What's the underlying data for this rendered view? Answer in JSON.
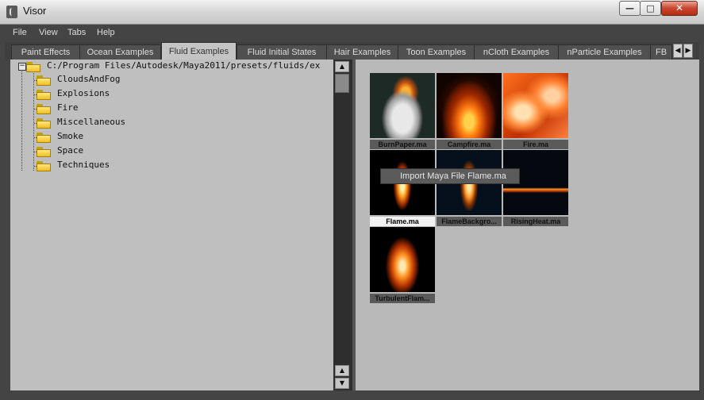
{
  "window": {
    "title": "Visor"
  },
  "menu": [
    "File",
    "View",
    "Tabs",
    "Help"
  ],
  "tabs": [
    {
      "label": "Paint Effects",
      "active": false
    },
    {
      "label": "Ocean Examples",
      "active": false
    },
    {
      "label": "Fluid Examples",
      "active": true
    },
    {
      "label": "Fluid Initial States",
      "active": false
    },
    {
      "label": "Hair Examples",
      "active": false
    },
    {
      "label": "Toon Examples",
      "active": false
    },
    {
      "label": "nCloth Examples",
      "active": false
    },
    {
      "label": "nParticle Examples",
      "active": false
    },
    {
      "label": "FB",
      "active": false
    }
  ],
  "tree": {
    "root": "C:/Program Files/Autodesk/Maya2011/presets/fluids/ex",
    "folders": [
      "CloudsAndFog",
      "Explosions",
      "Fire",
      "Miscellaneous",
      "Smoke",
      "Space",
      "Techniques"
    ]
  },
  "thumbnails": [
    {
      "label": "BurnPaper.ma",
      "selected": false
    },
    {
      "label": "Campfire.ma",
      "selected": false
    },
    {
      "label": "Fire.ma",
      "selected": false
    },
    {
      "label": "Flame.ma",
      "selected": true
    },
    {
      "label": "FlameBackgro...",
      "selected": false
    },
    {
      "label": "RisingHeat.ma",
      "selected": false
    },
    {
      "label": "TurbulentFlam...",
      "selected": false
    }
  ],
  "tooltip": "Import Maya File Flame.ma",
  "icons": {
    "app": "maya-icon",
    "minimize": "minimize-icon",
    "maximize": "maximize-icon",
    "close": "close-icon",
    "folder": "folder-icon"
  }
}
